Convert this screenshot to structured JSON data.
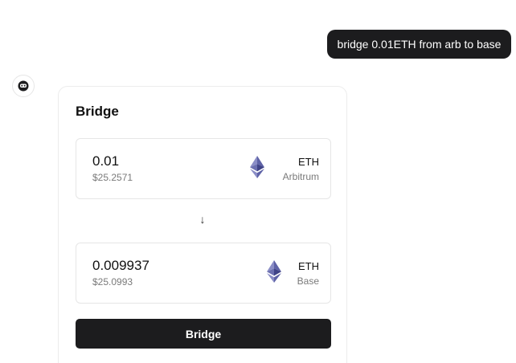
{
  "chat": {
    "user_message": "bridge 0.01ETH from arb to base",
    "bot_avatar_icon": "bot-face-icon"
  },
  "bridge_card": {
    "title": "Bridge",
    "from": {
      "amount": "0.01",
      "usd_value": "$25.2571",
      "token_symbol": "ETH",
      "chain": "Arbitrum",
      "icon": "ethereum-icon"
    },
    "arrow_icon": "arrow-down-icon",
    "to": {
      "amount": "0.009937",
      "usd_value": "$25.0993",
      "token_symbol": "ETH",
      "chain": "Base",
      "icon": "ethereum-icon"
    },
    "button_label": "Bridge"
  },
  "colors": {
    "dark": "#1c1c1e",
    "muted_text": "#7a7a7a",
    "border": "#e6e6e6",
    "eth_purple": "#6b6fb0"
  }
}
